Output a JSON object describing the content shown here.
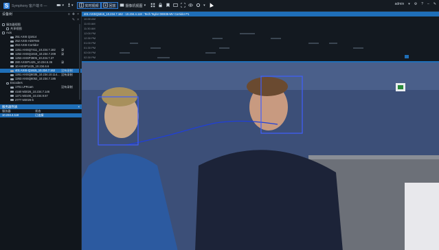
{
  "app": {
    "logo_letter": "S",
    "title": "Symphony 客户端 ® —"
  },
  "toolbar": {
    "items": [
      {
        "name": "live-view-button",
        "label": "实时视频",
        "active": true
      },
      {
        "name": "playback-button",
        "label": "回放",
        "active": true
      },
      {
        "name": "search-button",
        "label": "摄像机视图",
        "active": false
      }
    ],
    "user": "admin"
  },
  "left_panel": {
    "title": "设备树",
    "tree": [
      {
        "label": "服务器视图",
        "depth": 0,
        "type": "folder"
      },
      {
        "label": "共享视图",
        "depth": 1,
        "type": "folder"
      },
      {
        "label": "Axis",
        "depth": 0,
        "type": "folder"
      },
      {
        "label": "251 AXIS Q1614",
        "depth": 2,
        "type": "camera",
        "status": ""
      },
      {
        "label": "252 AXIS-AD07M4",
        "depth": 2,
        "type": "camera",
        "status": ""
      },
      {
        "label": "253 AXIS-Corridor",
        "depth": 2,
        "type": "camera",
        "status": ""
      },
      {
        "label": "1251 AXISQ7411_10.234.7.182",
        "depth": 2,
        "type": "camera",
        "status": "录"
      },
      {
        "label": "1252 AXISQ1615_10.234.7.209",
        "depth": 2,
        "type": "camera",
        "status": "录"
      },
      {
        "label": "1253 AXISP3905_10.234.7.27",
        "depth": 2,
        "type": "camera",
        "status": ""
      },
      {
        "label": "280 AXISP1425_10.234.5.36",
        "depth": 2,
        "type": "camera",
        "status": "录"
      },
      {
        "label": "10 AXISP1425_10.234.6.6",
        "depth": 2,
        "type": "camera",
        "status": ""
      },
      {
        "label": "401 AXIS-Q1615_10.234.7.162",
        "depth": 2,
        "type": "camera",
        "status": "没有录制",
        "selected": true
      },
      {
        "label": "1261 AXISQ6035_10.234.10.114...",
        "depth": 2,
        "type": "camera",
        "status": "没有录制"
      },
      {
        "label": "1263 AXISQ6052_10.234.7.185",
        "depth": 2,
        "type": "camera",
        "status": ""
      },
      {
        "label": "Encoders",
        "depth": 1,
        "type": "folder"
      },
      {
        "label": "1701 LPRcam",
        "depth": 2,
        "type": "camera",
        "status": "没有录制"
      },
      {
        "label": "4160 M3026_10.234.7.146",
        "depth": 2,
        "type": "camera",
        "status": ""
      },
      {
        "label": "1271 M3106_10.234.9.57",
        "depth": 2,
        "type": "camera",
        "status": ""
      },
      {
        "label": "2777 M3026-b",
        "depth": 2,
        "type": "camera",
        "status": ""
      }
    ]
  },
  "search_panel": {
    "title": "服务器列表",
    "col_name": "服务器",
    "col_status": "状态",
    "rows": [
      {
        "name": "10.234.4.118",
        "status": "已连接"
      }
    ]
  },
  "timeline": {
    "header": "401 AXISQ1615_10.234.7.162 - 10.234.4.118 : Tech Taylor DE835-MV Corridor P1",
    "times": [
      "10:30 AM",
      "11:00 AM",
      "11:30 AM",
      "12:00 PM",
      "12:30 PM",
      "01:00 PM",
      "01:30 PM",
      "02:00 PM",
      "02:30 PM"
    ]
  },
  "video": {
    "track_color": "#1f3fd8",
    "box_color": "#3f5fff"
  }
}
